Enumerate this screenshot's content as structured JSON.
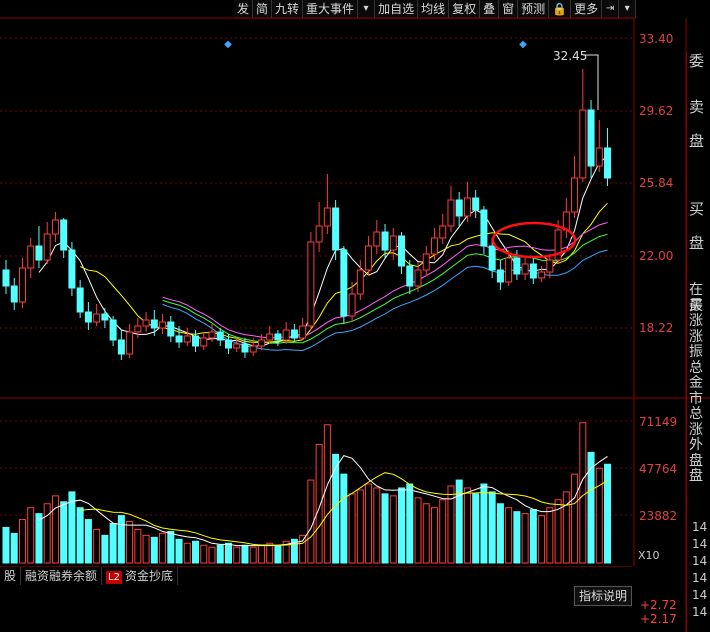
{
  "toolbar": {
    "items": [
      "发",
      "简",
      "九转",
      "重大事件",
      "▾",
      "加自选",
      "均线",
      "复权",
      "叠",
      "窗",
      "预测",
      "🔒",
      "更多",
      "⇥",
      "▾"
    ]
  },
  "price_axis": {
    "labels": [
      "33.40",
      "29.62",
      "25.84",
      "22.00",
      "18.22"
    ]
  },
  "volume_axis": {
    "labels": [
      "71149",
      "47764",
      "23882"
    ],
    "unit": "X10"
  },
  "max_price_label": "32.45",
  "side_panel": {
    "labels": [
      "委",
      "卖",
      "盘",
      "买",
      "盘"
    ],
    "rows": [
      "在买",
      "最",
      "涨",
      "涨",
      "振",
      "总",
      "金",
      "市",
      "总",
      "涨",
      "外",
      "盘",
      "盘"
    ],
    "times": [
      "14",
      "14",
      "14",
      "14",
      "14",
      "14"
    ]
  },
  "tabs": [
    "股",
    "融资融券余额",
    "L2",
    "资金抄底"
  ],
  "indicator_button": "指标说明",
  "pct_values": [
    "+2.72",
    "+2.17"
  ],
  "colors": {
    "up": "#ff3c3c",
    "down": "#54ffff",
    "ma5": "#ffffff",
    "ma10": "#ffff00",
    "ma20": "#ff60ff",
    "ma30": "#40ff40",
    "ma60": "#38a8ff",
    "grid": "#7a0000",
    "highlight": "#ff0000"
  },
  "chart_data": {
    "type": "candlestick",
    "price_range": [
      16.0,
      35.0
    ],
    "volume_range": [
      0,
      80000
    ],
    "candles": [
      [
        22.4,
        21.6,
        22.9,
        21.2,
        18000
      ],
      [
        21.6,
        20.8,
        22.0,
        20.4,
        15000
      ],
      [
        20.8,
        22.5,
        23.0,
        20.5,
        22000
      ],
      [
        22.5,
        23.6,
        24.0,
        22.0,
        28000
      ],
      [
        23.6,
        22.9,
        24.6,
        22.5,
        25000
      ],
      [
        22.9,
        24.2,
        24.8,
        22.7,
        30000
      ],
      [
        24.2,
        24.9,
        25.3,
        23.8,
        34000
      ],
      [
        24.9,
        23.4,
        25.0,
        23.0,
        31000
      ],
      [
        23.4,
        21.5,
        23.8,
        21.1,
        36000
      ],
      [
        21.5,
        20.3,
        21.9,
        20.0,
        28000
      ],
      [
        20.3,
        19.8,
        20.8,
        19.4,
        22000
      ],
      [
        19.8,
        20.2,
        20.7,
        19.6,
        17000
      ],
      [
        20.2,
        19.9,
        20.5,
        19.5,
        14000
      ],
      [
        19.9,
        18.9,
        20.1,
        18.6,
        20000
      ],
      [
        18.9,
        18.2,
        19.4,
        17.9,
        24000
      ],
      [
        18.2,
        19.3,
        19.7,
        18.0,
        21000
      ],
      [
        19.3,
        19.6,
        20.0,
        19.0,
        17000
      ],
      [
        19.6,
        19.9,
        20.3,
        19.3,
        14000
      ],
      [
        19.9,
        19.5,
        20.4,
        19.1,
        13000
      ],
      [
        19.5,
        19.8,
        20.2,
        19.2,
        15000
      ],
      [
        19.8,
        19.1,
        20.1,
        18.8,
        16000
      ],
      [
        19.1,
        18.8,
        19.6,
        18.5,
        12000
      ],
      [
        18.8,
        19.1,
        19.5,
        18.6,
        10000
      ],
      [
        19.1,
        18.6,
        19.4,
        18.3,
        11000
      ],
      [
        18.6,
        19.0,
        19.3,
        18.4,
        9000
      ],
      [
        19.0,
        19.3,
        19.7,
        18.8,
        8000
      ],
      [
        19.3,
        18.9,
        19.5,
        18.6,
        9000
      ],
      [
        18.9,
        18.5,
        19.2,
        18.2,
        10000
      ],
      [
        18.5,
        18.7,
        19.0,
        18.3,
        8000
      ],
      [
        18.7,
        18.3,
        19.0,
        18.0,
        9000
      ],
      [
        18.3,
        18.6,
        19.0,
        18.1,
        8000
      ],
      [
        18.6,
        18.9,
        19.2,
        18.4,
        9000
      ],
      [
        18.9,
        19.2,
        19.6,
        18.7,
        10000
      ],
      [
        19.2,
        18.9,
        19.4,
        18.6,
        9000
      ],
      [
        18.9,
        19.4,
        19.8,
        18.7,
        11000
      ],
      [
        19.4,
        19.0,
        19.7,
        18.8,
        12000
      ],
      [
        19.0,
        19.6,
        20.0,
        18.9,
        14000
      ],
      [
        19.6,
        23.8,
        24.3,
        19.4,
        42000
      ],
      [
        23.8,
        24.6,
        25.8,
        23.3,
        60000
      ],
      [
        24.6,
        25.5,
        27.2,
        24.2,
        70000
      ],
      [
        25.5,
        23.4,
        25.9,
        22.9,
        55000
      ],
      [
        23.4,
        20.1,
        23.6,
        19.7,
        45000
      ],
      [
        20.1,
        21.2,
        21.8,
        19.8,
        35000
      ],
      [
        21.2,
        22.4,
        22.9,
        20.9,
        37000
      ],
      [
        22.4,
        23.6,
        24.1,
        22.1,
        40000
      ],
      [
        23.6,
        24.3,
        24.9,
        23.2,
        38000
      ],
      [
        24.3,
        23.4,
        24.7,
        23.0,
        35000
      ],
      [
        23.4,
        24.1,
        24.5,
        22.9,
        34000
      ],
      [
        24.1,
        22.6,
        24.3,
        22.2,
        38000
      ],
      [
        22.6,
        21.6,
        22.9,
        21.2,
        40000
      ],
      [
        21.6,
        22.4,
        22.8,
        21.3,
        33000
      ],
      [
        22.4,
        23.2,
        23.6,
        22.1,
        30000
      ],
      [
        23.2,
        24.0,
        24.5,
        22.9,
        28000
      ],
      [
        24.0,
        24.6,
        25.2,
        23.7,
        32000
      ],
      [
        24.6,
        25.9,
        26.6,
        24.3,
        39000
      ],
      [
        25.9,
        25.1,
        26.3,
        24.6,
        42000
      ],
      [
        25.1,
        26.0,
        26.8,
        24.8,
        38000
      ],
      [
        26.0,
        25.4,
        26.4,
        25.0,
        35000
      ],
      [
        25.4,
        23.6,
        25.6,
        23.2,
        40000
      ],
      [
        23.6,
        22.4,
        24.0,
        22.0,
        36000
      ],
      [
        22.4,
        21.8,
        22.9,
        21.4,
        30000
      ],
      [
        21.8,
        23.0,
        23.4,
        21.6,
        28000
      ],
      [
        23.0,
        22.2,
        23.4,
        21.9,
        26000
      ],
      [
        22.2,
        22.7,
        23.0,
        21.9,
        25000
      ],
      [
        22.7,
        22.0,
        23.0,
        21.7,
        27000
      ],
      [
        22.0,
        22.3,
        22.6,
        21.8,
        24000
      ],
      [
        22.3,
        22.9,
        23.2,
        22.0,
        28000
      ],
      [
        22.9,
        24.4,
        24.9,
        22.7,
        32000
      ],
      [
        24.4,
        25.3,
        26.0,
        24.0,
        36000
      ],
      [
        25.3,
        27.0,
        28.1,
        25.0,
        45000
      ],
      [
        27.0,
        30.4,
        32.45,
        26.8,
        71000
      ],
      [
        30.4,
        27.6,
        30.9,
        27.0,
        56000
      ],
      [
        27.6,
        28.5,
        29.9,
        27.3,
        48000
      ],
      [
        28.5,
        27.0,
        29.5,
        26.6,
        50000
      ]
    ],
    "markers": [
      "◆",
      "◆"
    ]
  }
}
